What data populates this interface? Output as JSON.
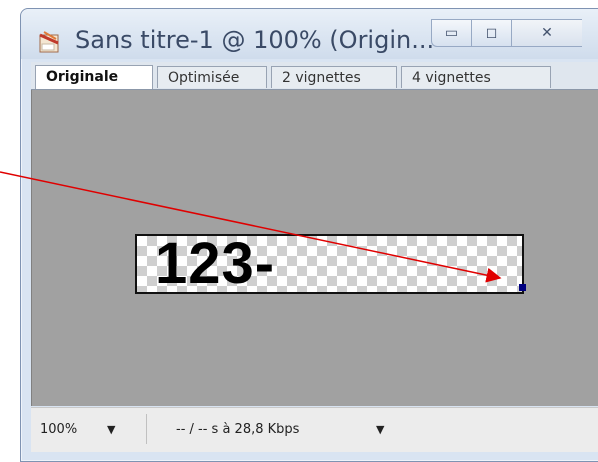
{
  "window": {
    "title": "Sans titre-1 @ 100% (Origin...",
    "minimize_glyph": "▭",
    "maximize_glyph": "◻",
    "close_glyph": "✕"
  },
  "tabs": [
    {
      "label": "Originale",
      "active": true
    },
    {
      "label": "Optimisée",
      "active": false
    },
    {
      "label": "2 vignettes",
      "active": false
    },
    {
      "label": "4 vignettes",
      "active": false
    }
  ],
  "tab_overflow": "»",
  "canvas": {
    "image_text": "123-"
  },
  "status": {
    "zoom": "100%",
    "zoom_arrow": "▼",
    "rate": "-- / -- s à 28,8 Kbps",
    "rate_arrow": "▼"
  },
  "colors": {
    "annotation_arrow": "#e00000",
    "canvas_bg": "#a1a1a1",
    "cursor_pixel": "#000080"
  }
}
